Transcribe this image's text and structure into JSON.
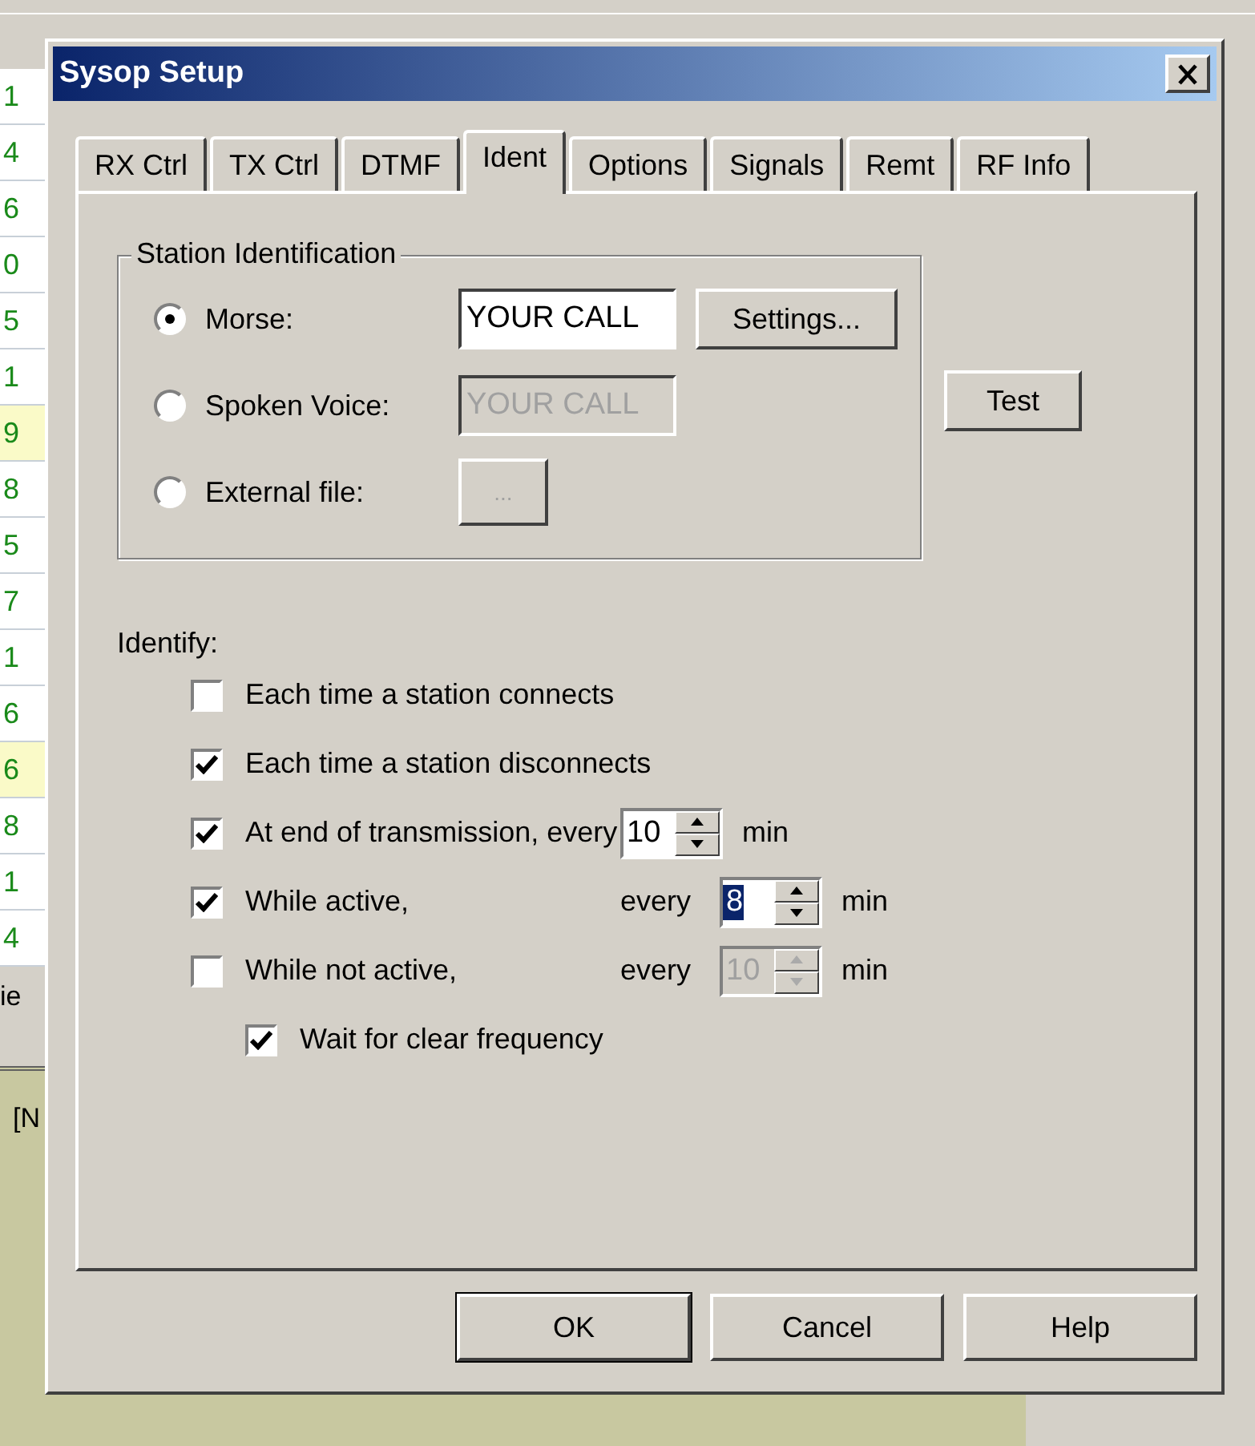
{
  "background": {
    "list": [
      {
        "text": "1",
        "highlighted": false
      },
      {
        "text": "4",
        "highlighted": false
      },
      {
        "text": "6",
        "highlighted": false
      },
      {
        "text": "0",
        "highlighted": false
      },
      {
        "text": "5",
        "highlighted": false
      },
      {
        "text": "1",
        "highlighted": false
      },
      {
        "text": "9",
        "highlighted": true
      },
      {
        "text": "8",
        "highlighted": false
      },
      {
        "text": "5",
        "highlighted": false
      },
      {
        "text": "7",
        "highlighted": false
      },
      {
        "text": "1",
        "highlighted": false
      },
      {
        "text": "6",
        "highlighted": false
      },
      {
        "text": "6",
        "highlighted": true
      },
      {
        "text": "8",
        "highlighted": false
      },
      {
        "text": "1",
        "highlighted": false
      },
      {
        "text": "4",
        "highlighted": false
      }
    ],
    "tab_fragment": "ie",
    "log_fragment": "[N"
  },
  "dialog": {
    "title": "Sysop Setup",
    "tabs": [
      {
        "label": "RX Ctrl",
        "selected": false
      },
      {
        "label": "TX Ctrl",
        "selected": false
      },
      {
        "label": "DTMF",
        "selected": false
      },
      {
        "label": "Ident",
        "selected": true
      },
      {
        "label": "Options",
        "selected": false
      },
      {
        "label": "Signals",
        "selected": false
      },
      {
        "label": "Remt",
        "selected": false
      },
      {
        "label": "RF Info",
        "selected": false
      }
    ],
    "station_identification": {
      "title": "Station Identification",
      "options": [
        {
          "kind": "field",
          "label": "Morse:",
          "selected": true,
          "value": "YOUR CALL",
          "disabled": false,
          "button": "Settings..."
        },
        {
          "kind": "field",
          "label": "Spoken Voice:",
          "selected": false,
          "value": "YOUR CALL",
          "disabled": true
        },
        {
          "kind": "file",
          "label": "External file:",
          "selected": false,
          "button": "...",
          "disabled": true
        }
      ]
    },
    "test_button": "Test",
    "identify": {
      "label": "Identify:",
      "items": [
        {
          "kind": "check",
          "label": "Each time a station connects",
          "checked": false
        },
        {
          "kind": "check",
          "label": "Each time a station disconnects",
          "checked": true
        },
        {
          "kind": "interval",
          "label": "At end of transmission, every",
          "checked": true,
          "value": "10",
          "disabled": false,
          "focused": false,
          "unit": "min"
        },
        {
          "kind": "interval",
          "label": "While active,",
          "every": "every",
          "checked": true,
          "value": "8",
          "disabled": false,
          "focused": true,
          "unit": "min"
        },
        {
          "kind": "interval",
          "label": "While not active,",
          "every": "every",
          "checked": false,
          "value": "10",
          "disabled": true,
          "focused": false,
          "unit": "min"
        },
        {
          "kind": "sub",
          "label": "Wait for clear frequency",
          "checked": true
        }
      ]
    },
    "buttons": [
      {
        "label": "OK",
        "default": true
      },
      {
        "label": "Cancel",
        "default": false
      },
      {
        "label": "Help",
        "default": false
      }
    ]
  }
}
